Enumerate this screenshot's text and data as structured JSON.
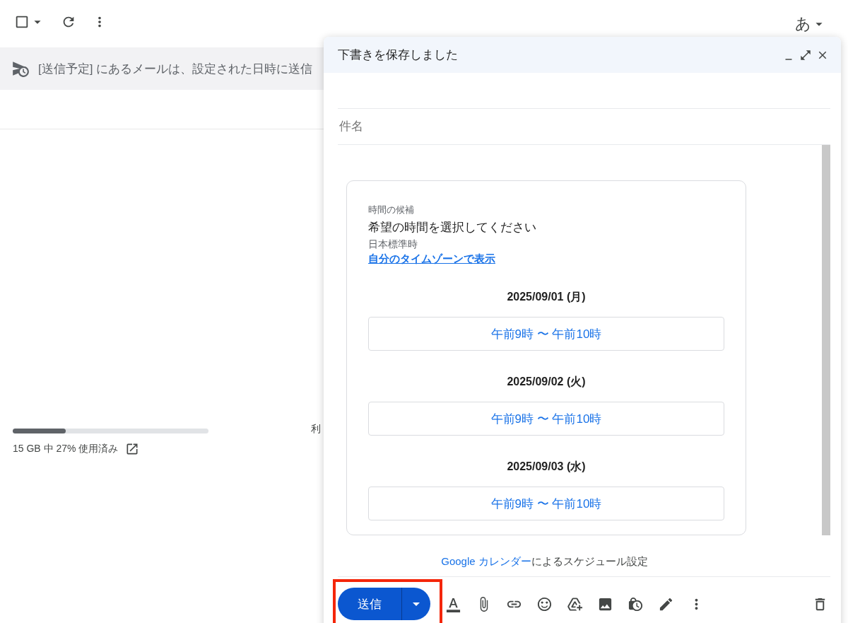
{
  "inbox": {
    "select_all": {
      "checked": false
    },
    "ime_indicator": "あ",
    "banner": "[送信予定] にあるメールは、設定された日時に送信",
    "storage": {
      "level": 0.27,
      "text": "15 GB 中 27% 使用済み"
    },
    "cut_text": "利"
  },
  "compose": {
    "title": "下書きを保存しました",
    "subject_placeholder": "件名",
    "card": {
      "caption": "時間の候補",
      "heading": "希望の時間を選択してください",
      "timezone": "日本標準時",
      "timezone_link": "自分のタイムゾーンで表示",
      "days": [
        {
          "date": "2025/09/01 (月)",
          "slot": "午前9時 〜 午前10時"
        },
        {
          "date": "2025/09/02 (火)",
          "slot": "午前9時 〜 午前10時"
        },
        {
          "date": "2025/09/03 (水)",
          "slot": "午前9時 〜 午前10時"
        }
      ]
    },
    "footer_link": "Google カレンダー",
    "footer_text": "によるスケジュール設定",
    "send_label": "送信",
    "send_highlighted": true
  }
}
